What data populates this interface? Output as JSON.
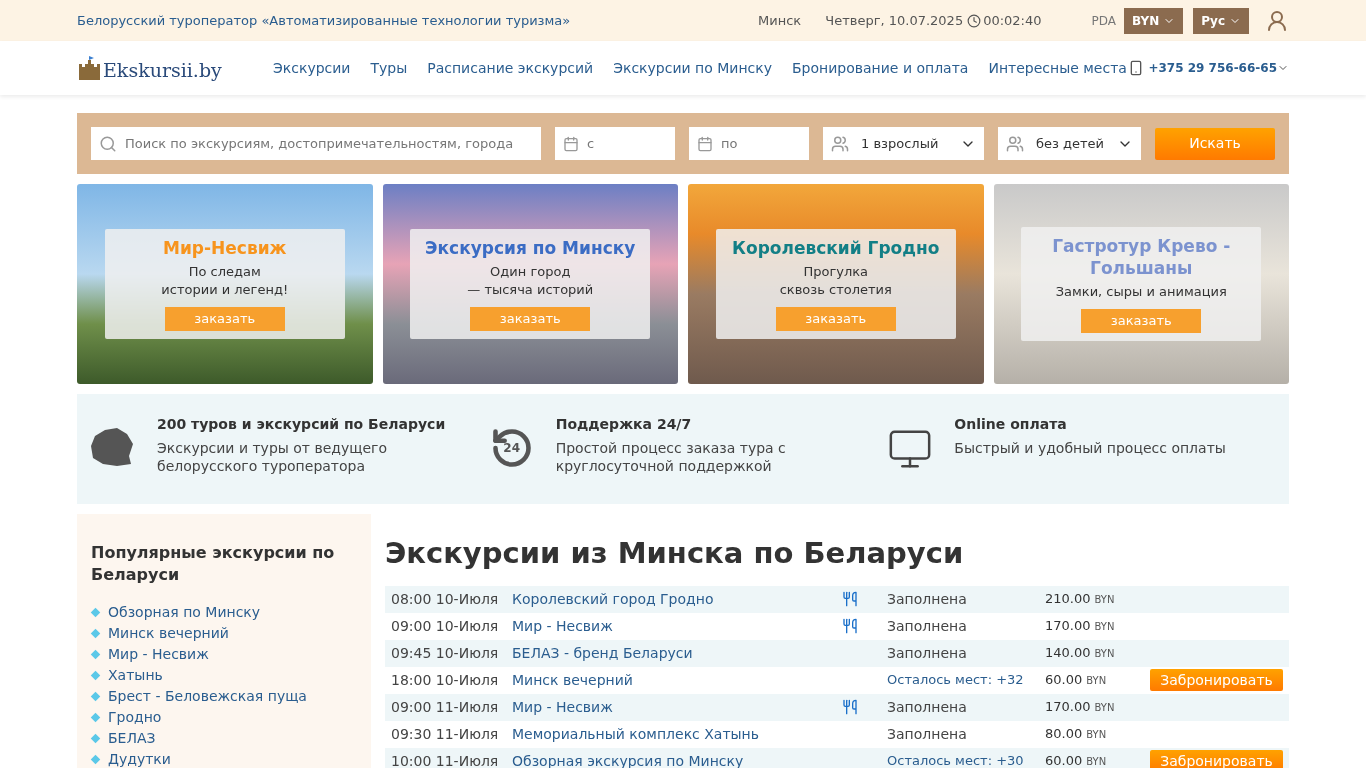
{
  "topbar": {
    "tagline": "Белорусский туроператор «Автоматизированные технологии туризма»",
    "city": "Минск",
    "date": "Четверг, 10.07.2025",
    "time": "00:02:40",
    "pda": "PDA",
    "currency": "BYN",
    "language": "Рус"
  },
  "header": {
    "logo": "Ekskursii.by",
    "nav": [
      "Экскурсии",
      "Туры",
      "Расписание экскурсий",
      "Экскурсии по Минску",
      "Бронирование и оплата",
      "Интересные места"
    ],
    "phone": "+375 29 756-66-65"
  },
  "search": {
    "query_placeholder": "Поиск по экскурсиям, достопримечательностям, города",
    "from_placeholder": "с",
    "to_placeholder": "по",
    "adults": "1 взрослый",
    "children": "без детей",
    "button": "Искать"
  },
  "banners": [
    {
      "title": "Мир-Несвиж",
      "color": "#f7941d",
      "subtitle": [
        "По следам",
        "истории и легенд!"
      ],
      "button": "заказать"
    },
    {
      "title": "Экскурсия по Минску",
      "color": "#3b6cc4",
      "subtitle": [
        "Один город",
        "— тысяча историй"
      ],
      "button": "заказать"
    },
    {
      "title": "Королевский Гродно",
      "color": "#127f86",
      "subtitle": [
        "Прогулка",
        "сквозь столетия"
      ],
      "button": "заказать"
    },
    {
      "title": "Гастротур Крево - Гольшаны",
      "color": "#7c93cf",
      "subtitle": [
        "Замки, сыры и анимация"
      ],
      "button": "заказать"
    }
  ],
  "features": [
    {
      "kind": "map",
      "title": "200 туров и экскурсий по Беларуси",
      "text": "Экскурсии и туры от ведущего белорусского туроператора"
    },
    {
      "kind": "support",
      "icon_text": "24",
      "title": "Поддержка 24/7",
      "text": "Простой процесс заказа тура с круглосуточной поддержкой"
    },
    {
      "kind": "payment",
      "title": "Online оплата",
      "text": "Быстрый и удобный процесс оплаты"
    }
  ],
  "sidebar": {
    "title": "Популярные экскурсии по Беларуси",
    "items": [
      "Обзорная по Минску",
      "Минск вечерний",
      "Мир - Несвиж",
      "Хатынь",
      "Брест - Беловежская пуща",
      "Гродно",
      "БЕЛАЗ",
      "Дудутки"
    ]
  },
  "schedule": {
    "title": "Экскурсии из Минска по Беларуси",
    "rows": [
      {
        "time": "08:00 10-Июля",
        "name": "Королевский город Гродно",
        "meal": true,
        "kind": "full",
        "status": "Заполнена",
        "price": "210.00",
        "currency": "BYN"
      },
      {
        "time": "09:00 10-Июля",
        "name": "Мир - Несвиж",
        "meal": true,
        "kind": "full",
        "status": "Заполнена",
        "price": "170.00",
        "currency": "BYN"
      },
      {
        "time": "09:45 10-Июля",
        "name": "БЕЛАЗ - бренд Беларуси",
        "meal": false,
        "kind": "full",
        "status": "Заполнена",
        "price": "140.00",
        "currency": "BYN"
      },
      {
        "time": "18:00 10-Июля",
        "name": "Минск вечерний",
        "meal": false,
        "kind": "open",
        "status": "Осталось мест: +32",
        "price": "60.00",
        "currency": "BYN",
        "button": "Забронировать"
      },
      {
        "time": "09:00 11-Июля",
        "name": "Мир - Несвиж",
        "meal": true,
        "kind": "full",
        "status": "Заполнена",
        "price": "170.00",
        "currency": "BYN"
      },
      {
        "time": "09:30 11-Июля",
        "name": "Мемориальный комплекс Хатынь",
        "meal": false,
        "kind": "full",
        "status": "Заполнена",
        "price": "80.00",
        "currency": "BYN"
      },
      {
        "time": "10:00 11-Июля",
        "name": "Обзорная экскурсия по Минску",
        "meal": false,
        "kind": "open",
        "status": "Осталось мест: +30",
        "price": "60.00",
        "currency": "BYN",
        "button": "Забронировать"
      }
    ]
  }
}
